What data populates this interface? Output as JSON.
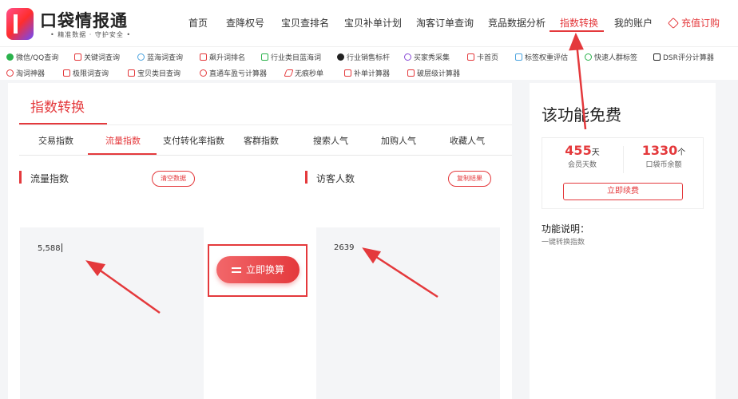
{
  "brand": {
    "name": "口袋情报通",
    "slogan": "• 精准数据 · 守护安全 •"
  },
  "nav": {
    "items": [
      "首页",
      "查降权号",
      "宝贝查排名",
      "宝贝补单计划",
      "淘客订单查询",
      "竞品数据分析",
      "指数转换",
      "我的账户"
    ],
    "recharge": "充值订购"
  },
  "tools": {
    "row1": [
      "微信/QQ查询",
      "关键词查询",
      "蓝海词查询",
      "飙升词排名",
      "行业类目蓝海词",
      "行业销售标杆",
      "买家秀采集",
      "卡首页",
      "标签权重评估",
      "快速人群标签",
      "DSR评分计算器"
    ],
    "row2": [
      "淘词神器",
      "极限词查询",
      "宝贝类目查询",
      "直通车盈亏计算器",
      "无痕秒单",
      "补单计算器",
      "破层级计算器"
    ]
  },
  "panel": {
    "title": "指数转换",
    "subtabs": [
      "交易指数",
      "流量指数",
      "支付转化率指数",
      "客群指数",
      "搜索人气",
      "加购人气",
      "收藏人气"
    ],
    "left": {
      "title": "流量指数",
      "button": "清空数据",
      "value": "5,588"
    },
    "right": {
      "title": "访客人数",
      "button": "复制结果",
      "value": "2639"
    },
    "convert": "立即换算"
  },
  "side": {
    "title": "该功能免费",
    "member_days": {
      "value": "455",
      "unit": "天",
      "label": "会员天数"
    },
    "coins": {
      "value": "1330",
      "unit": "个",
      "label": "口袋币余额"
    },
    "renew": "立即续费",
    "desc_title": "功能说明：",
    "desc_text": "一键转换指数"
  },
  "colors": {
    "accent": "#e4393c",
    "background": "#f4f5f7"
  }
}
